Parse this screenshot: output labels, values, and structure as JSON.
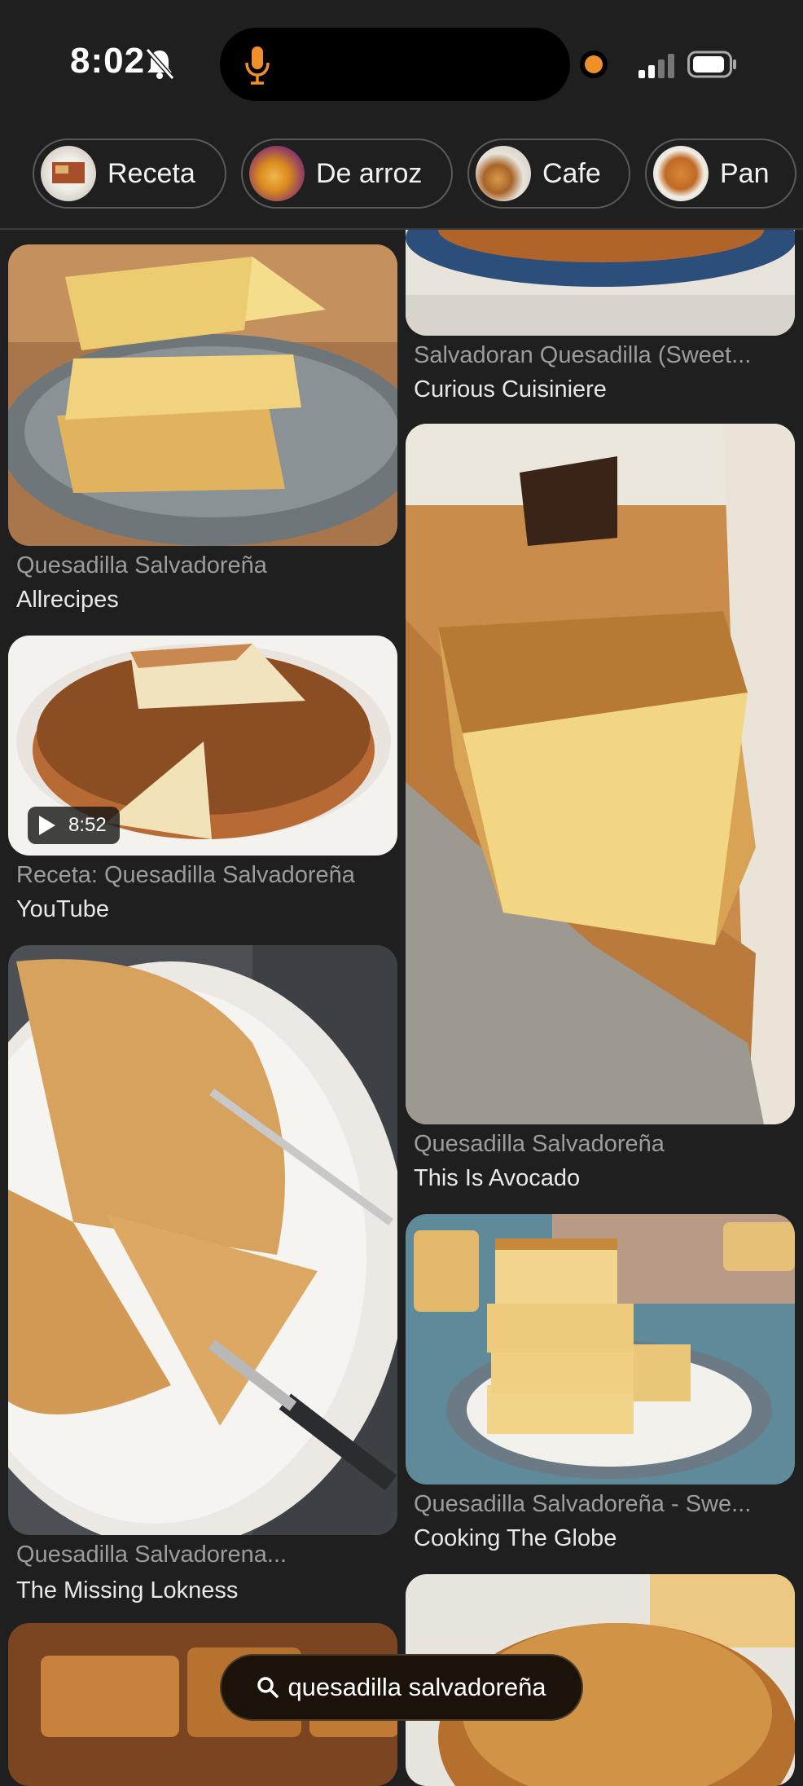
{
  "status": {
    "time": "8:02"
  },
  "chips": [
    {
      "label": "Receta"
    },
    {
      "label": "De arroz"
    },
    {
      "label": "Cafe"
    },
    {
      "label": "Pan"
    }
  ],
  "results": {
    "left": [
      {
        "title": "Quesadilla Salvadoreña",
        "source": "Allrecipes"
      },
      {
        "title": "Receta: Quesadilla Salvadoreña",
        "source": "YouTube",
        "duration": "8:52"
      },
      {
        "title": "Quesadilla Salvadorena...",
        "source": "The Missing Lokness"
      }
    ],
    "right": [
      {
        "title": "Salvadoran Quesadilla (Sweet...",
        "source": "Curious Cuisiniere"
      },
      {
        "title": "Quesadilla Salvadoreña",
        "source": "This Is Avocado"
      },
      {
        "title": "Quesadilla Salvadoreña - Swe...",
        "source": "Cooking The Globe"
      }
    ]
  },
  "search": {
    "query": "quesadilla salvadoreña"
  },
  "colors": {
    "background": "#1f1f1f",
    "mic": "#f0902a",
    "pill": "#1b120a"
  }
}
